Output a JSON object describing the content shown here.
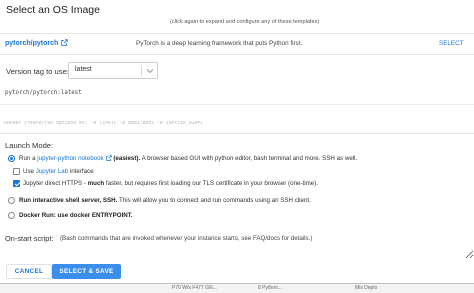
{
  "dialog": {
    "title": "Select an OS Image",
    "hint": "(click again to expand and configure any of these templates)"
  },
  "template": {
    "name": "pytorch/pytorch",
    "description": "PyTorch is a deep learning framework that puts Python first.",
    "select_label": "SELECT"
  },
  "version": {
    "label": "Version tag to use:",
    "value": "latest",
    "options": [
      "latest"
    ]
  },
  "image_path": "pytorch/pytorch:latest",
  "docker_options": {
    "placeholder": "Docker create/run options ex: -e TZ=UTC -p 8081:8081 -e JUPYTER_DIR=/"
  },
  "launch": {
    "title": "Launch Mode:",
    "jupyter": {
      "run_prefix": "Run a",
      "notebook_link": "jupyter-python notebook",
      "bold": "(easiest).",
      "rest": "A browser based GUI with python editor, bash terminal and more. SSH as well.",
      "use_lab_prefix": "Use",
      "use_lab_link": "Jupyter Lab",
      "use_lab_suffix": "interface",
      "https_prefix": "Jupyter direct HTTPS -",
      "https_bold": "much",
      "https_rest": "faster, but requires first loading our TLS certificate in your browser (one-time)."
    },
    "ssh": {
      "bold": "Run interactive shell server, SSH.",
      "rest": "This will allow you to connect and run commands using an SSH client."
    },
    "docker": {
      "bold": "Docker Run: use docker ENTRYPOINT."
    }
  },
  "onstart": {
    "label": "On-start script:",
    "help": "(Bash commands that are invoked whenever your instance starts, see FAQ/docs for details.)"
  },
  "buttons": {
    "cancel": "CANCEL",
    "save": "SELECT & SAVE"
  },
  "background": {
    "left_text": "P70 W/s F477 GN...",
    "center_text": "8 Python...",
    "right_text": "Mis Deplo"
  },
  "colors": {
    "accent": "#1976d2",
    "primary_button": "#3b8ee9"
  }
}
